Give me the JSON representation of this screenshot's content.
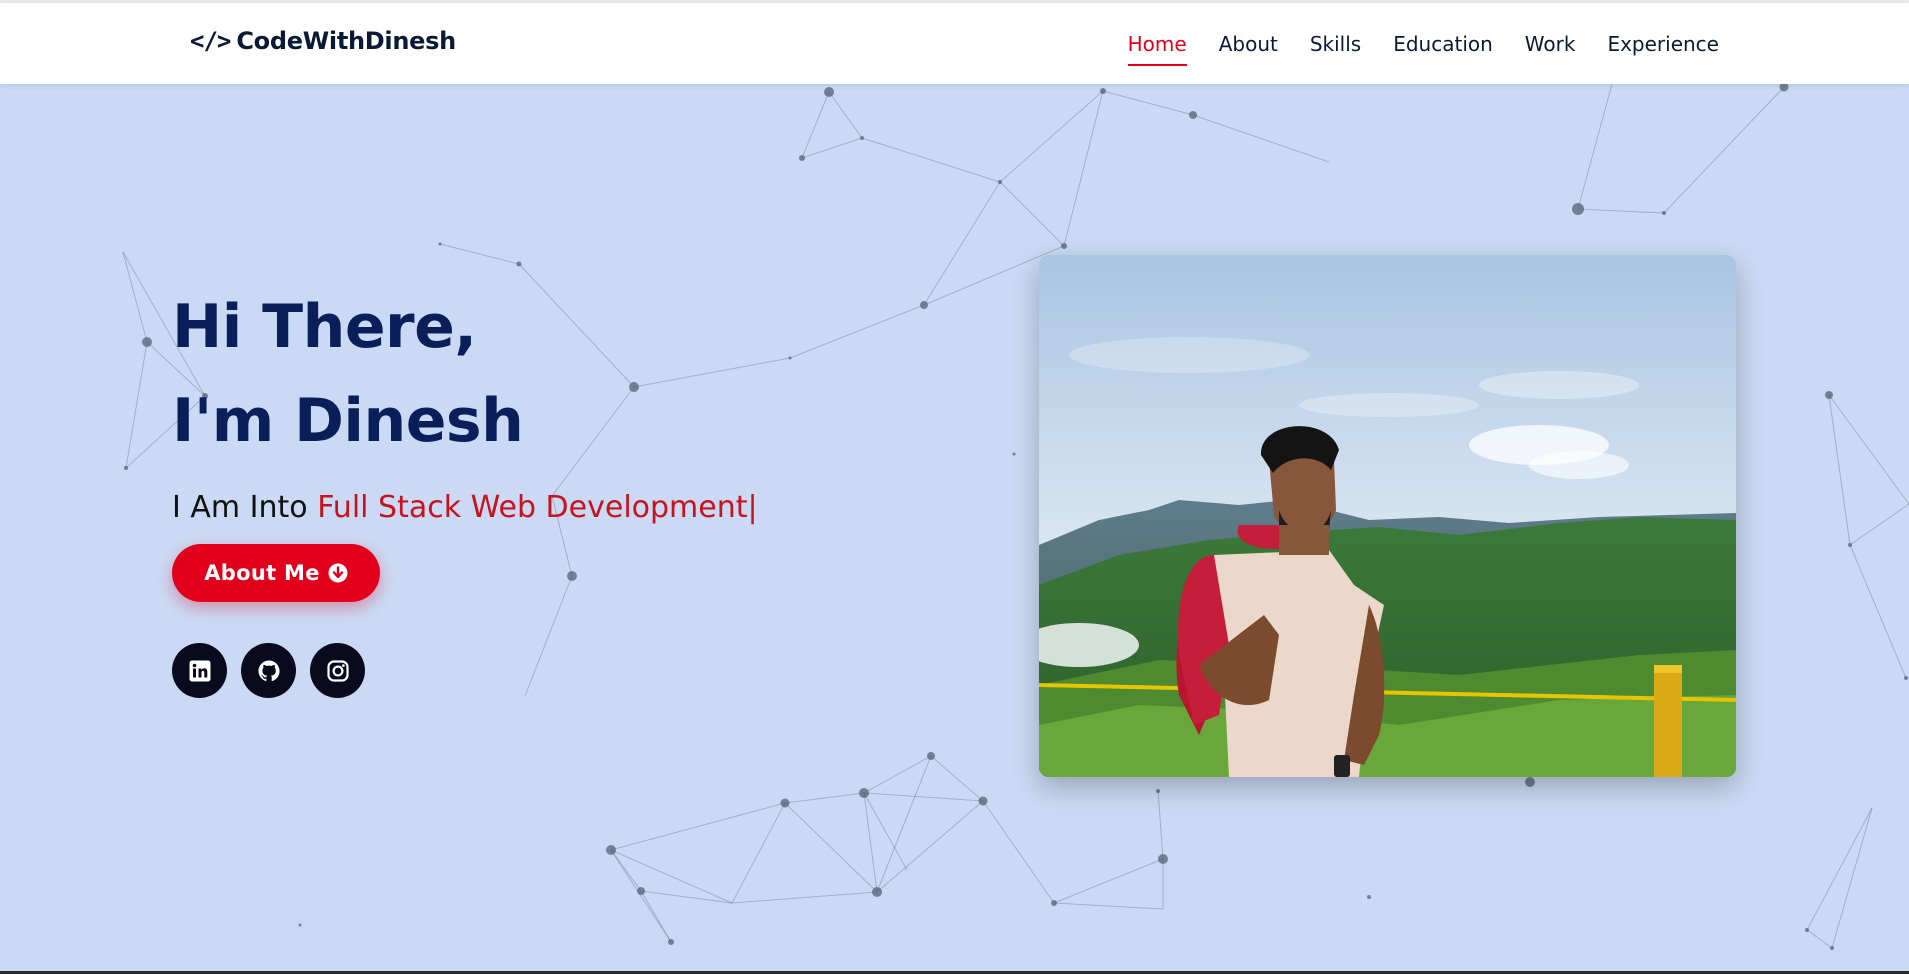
{
  "brand": {
    "icon": "code-icon",
    "icon_glyph": "</>",
    "name": "CodeWithDinesh"
  },
  "nav": {
    "items": [
      {
        "label": "Home",
        "active": true
      },
      {
        "label": "About"
      },
      {
        "label": "Skills"
      },
      {
        "label": "Education"
      },
      {
        "label": "Work"
      },
      {
        "label": "Experience"
      }
    ]
  },
  "hero": {
    "line1": "Hi There,",
    "line2": "I'm Dinesh",
    "tagline_prefix": "I Am Into ",
    "tagline_role": "Full Stack Web Development",
    "cursor": "|",
    "about_button": {
      "label": "About Me",
      "icon": "arrow-down-circle-icon"
    }
  },
  "socials": [
    {
      "name": "linkedin",
      "icon": "linkedin-icon"
    },
    {
      "name": "github",
      "icon": "github-icon"
    },
    {
      "name": "instagram",
      "icon": "instagram-icon"
    }
  ],
  "colors": {
    "background": "#cadaf4",
    "accent": "#e0001c",
    "heading": "#0a1f59",
    "nav_text": "#0b1a33",
    "social_bg": "#0a0a1e"
  }
}
